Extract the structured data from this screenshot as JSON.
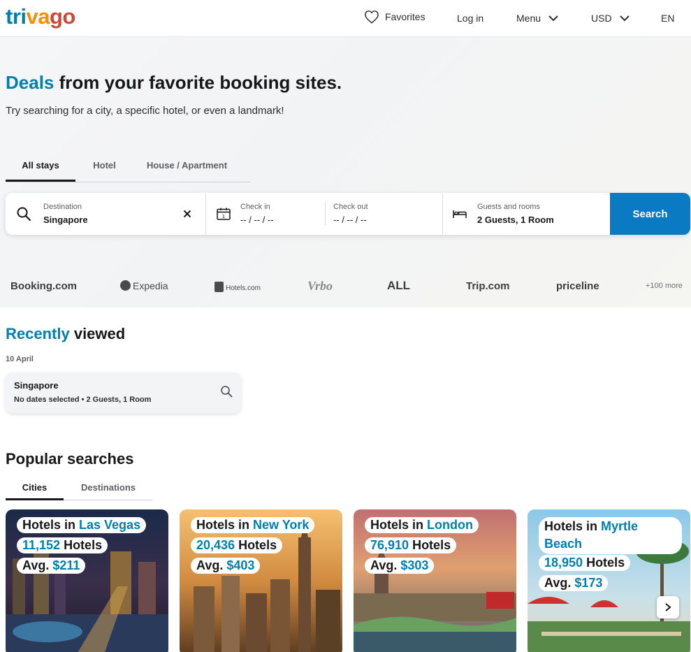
{
  "header": {
    "logo": {
      "part1": "tri",
      "part2": "va",
      "part3": "go"
    },
    "favorites": "Favorites",
    "login": "Log in",
    "menu": "Menu",
    "currency": "USD",
    "language": "EN"
  },
  "hero": {
    "title_accent": "Deals",
    "title_rest": " from your favorite booking sites.",
    "subtitle": "Try searching for a city, a specific hotel, or even a landmark!",
    "tabs": [
      "All stays",
      "Hotel",
      "House / Apartment"
    ]
  },
  "search": {
    "destination_label": "Destination",
    "destination_value": "Singapore",
    "checkin_label": "Check in",
    "checkin_value": "-- / -- / --",
    "checkout_label": "Check out",
    "checkout_value": "-- / -- / --",
    "guests_label": "Guests and rooms",
    "guests_value": "2 Guests, 1 Room",
    "button": "Search"
  },
  "partners": [
    "Booking.com",
    "Expedia",
    "Hotels.com",
    "Vrbo",
    "ALL",
    "Trip.com",
    "priceline",
    "+100 more"
  ],
  "recently_viewed": {
    "title_accent": "Recently",
    "title_rest": " viewed",
    "date": "10 April",
    "card": {
      "city": "Singapore",
      "details": "No dates selected • 2 Guests, 1 Room"
    }
  },
  "popular": {
    "title": "Popular searches",
    "tabs": [
      "Cities",
      "Destinations"
    ],
    "prefix_hotels_in": "Hotels in ",
    "hotels_word": " Hotels",
    "avg_word": "Avg. ",
    "cards": [
      {
        "city": "Las Vegas",
        "count": "11,152",
        "avg": "$211"
      },
      {
        "city": "New York",
        "count": "20,436",
        "avg": "$403"
      },
      {
        "city": "London",
        "count": "76,910",
        "avg": "$303"
      },
      {
        "city": "Myrtle Beach",
        "city_line1": "Myrtle",
        "city_line2": "Beach",
        "count": "18,950",
        "avg": "$173"
      }
    ]
  },
  "colors": {
    "accent": "#007fad",
    "search_button": "#0a7bc2"
  }
}
